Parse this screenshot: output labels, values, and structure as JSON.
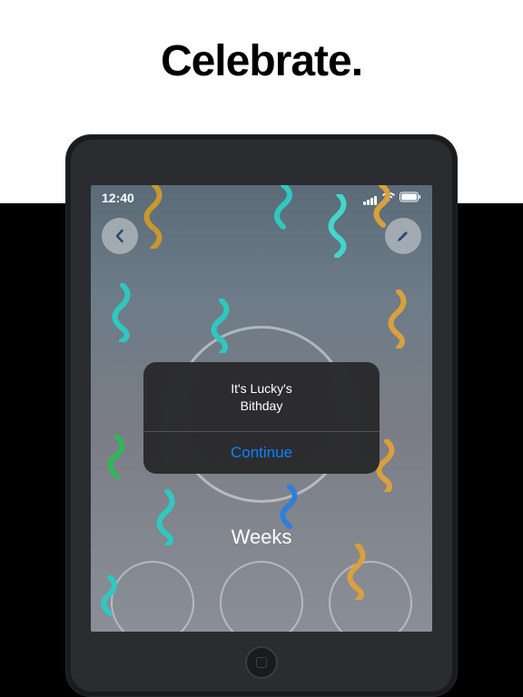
{
  "headline": "Celebrate.",
  "status": {
    "time": "12:40"
  },
  "alert": {
    "line1": "It's Lucky's",
    "line2": "Bithday",
    "button": "Continue"
  },
  "labels": {
    "weeks": "Weeks"
  },
  "colors": {
    "accent_blue": "#0a84ff",
    "streamer_teal": "#2fc8c0",
    "streamer_gold": "#d9a03c",
    "streamer_green": "#2fb85a",
    "streamer_blue": "#2f7fd9"
  }
}
